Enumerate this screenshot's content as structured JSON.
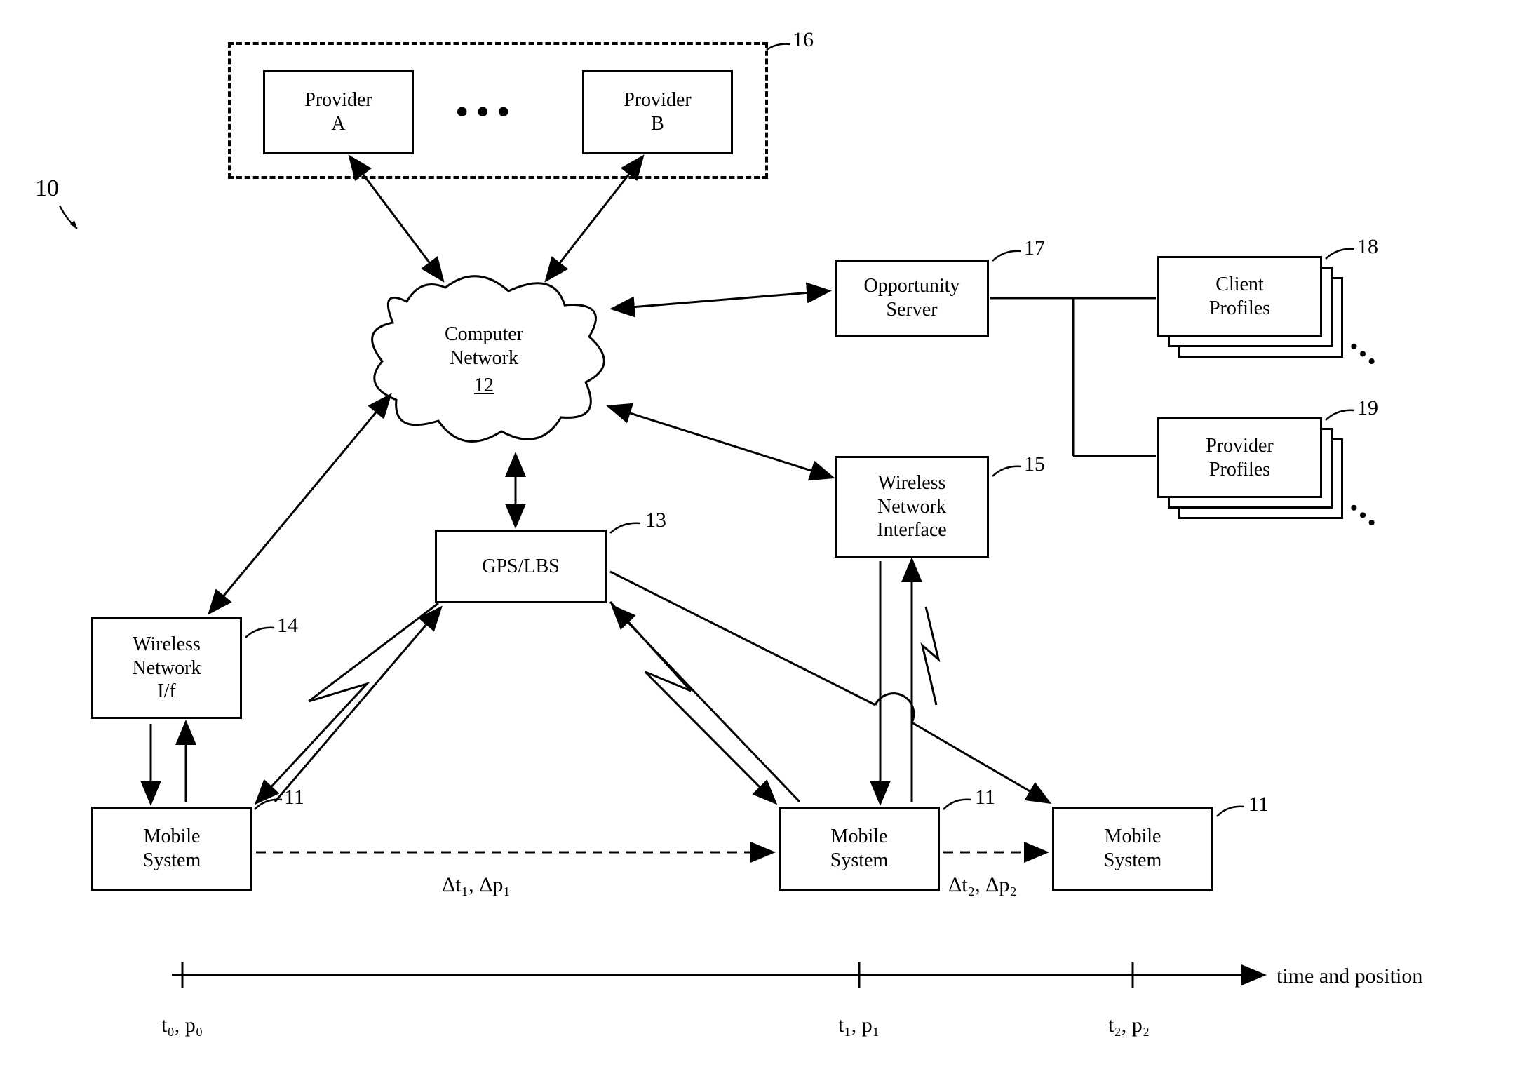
{
  "figure_label": "10",
  "providers_group": {
    "ref": "16",
    "provider_a": {
      "line1": "Provider",
      "line2": "A"
    },
    "provider_b": {
      "line1": "Provider",
      "line2": "B"
    }
  },
  "computer_network": {
    "line1": "Computer",
    "line2": "Network",
    "ref": "12"
  },
  "opportunity_server": {
    "line1": "Opportunity",
    "line2": "Server",
    "ref": "17"
  },
  "client_profiles": {
    "line1": "Client",
    "line2": "Profiles",
    "ref": "18"
  },
  "provider_profiles": {
    "line1": "Provider",
    "line2": "Profiles",
    "ref": "19"
  },
  "gps_lbs": {
    "label": "GPS/LBS",
    "ref": "13"
  },
  "wireless_if_left": {
    "line1": "Wireless",
    "line2": "Network",
    "line3": "I/f",
    "ref": "14"
  },
  "wireless_if_right": {
    "line1": "Wireless",
    "line2": "Network",
    "line3": "Interface",
    "ref": "15"
  },
  "mobile_system_1": {
    "line1": "Mobile",
    "line2": "System",
    "ref": "11"
  },
  "mobile_system_2": {
    "line1": "Mobile",
    "line2": "System",
    "ref": "11"
  },
  "mobile_system_3": {
    "line1": "Mobile",
    "line2": "System",
    "ref": "11"
  },
  "timeline": {
    "label": "time and position",
    "tick0": "t₀, p₀",
    "tick1": "t₁, p₁",
    "tick2": "t₂, p₂",
    "delta1": "Δt₁, Δp₁",
    "delta2": "Δt₂, Δp₂"
  }
}
